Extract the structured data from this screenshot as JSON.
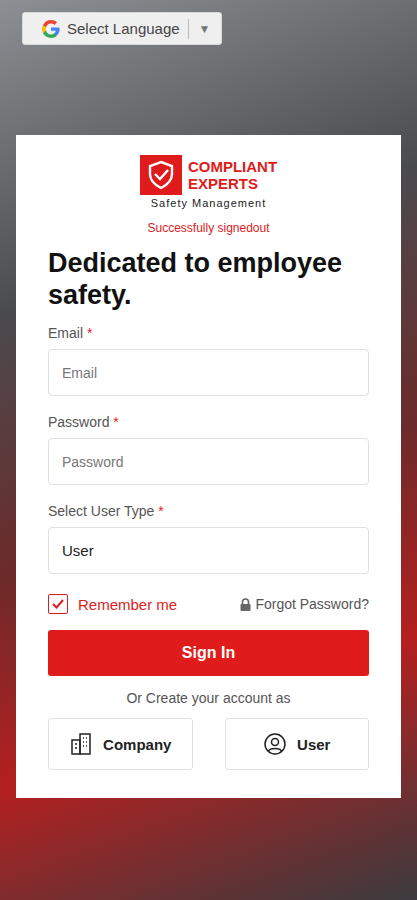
{
  "language_selector": {
    "label": "Select Language",
    "arrow": "▼"
  },
  "logo": {
    "line1": "COMPLIANT",
    "line2": "EXPERTS",
    "tagline": "Safety Management"
  },
  "status_message": "Successfully signedout",
  "heading": "Dedicated to employee safety.",
  "fields": [
    {
      "label": "Email",
      "required_mark": "*",
      "kind": "text",
      "placeholder": "Email",
      "value": ""
    },
    {
      "label": "Password",
      "required_mark": "*",
      "kind": "password",
      "placeholder": "Password",
      "value": ""
    },
    {
      "label": "Select User Type",
      "required_mark": "*",
      "kind": "select",
      "placeholder": "",
      "value": "User"
    }
  ],
  "remember_me": {
    "label": "Remember me",
    "checked": true
  },
  "forgot_password": {
    "label": "Forgot Password?"
  },
  "sign_in_button": {
    "label": "Sign In"
  },
  "create_account": {
    "prompt": "Or Create your account as",
    "options": [
      {
        "label": "Company",
        "kind": "company"
      },
      {
        "label": "User",
        "kind": "user"
      }
    ]
  }
}
